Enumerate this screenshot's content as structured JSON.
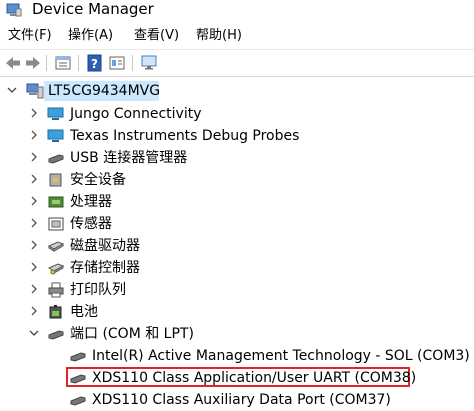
{
  "window": {
    "title": "Device Manager"
  },
  "menu": [
    {
      "label": "文件(F)"
    },
    {
      "label": "操作(A)"
    },
    {
      "label": "查看(V)"
    },
    {
      "label": "帮助(H)"
    }
  ],
  "toolbar": {
    "icons": [
      "back-arrow-icon",
      "forward-arrow-icon",
      "properties-icon",
      "help-icon",
      "details-icon",
      "monitor-icon"
    ]
  },
  "tree": {
    "root": {
      "label": "LT5CG9434MVG",
      "icon": "computer-icon"
    },
    "categories": [
      {
        "label": "Jungo Connectivity",
        "icon": "monitor-icon"
      },
      {
        "label": "Texas Instruments Debug Probes",
        "icon": "probe-icon"
      },
      {
        "label": "USB 连接器管理器",
        "icon": "usb-icon"
      },
      {
        "label": "安全设备",
        "icon": "security-icon"
      },
      {
        "label": "处理器",
        "icon": "chip-icon"
      },
      {
        "label": "传感器",
        "icon": "sensor-icon"
      },
      {
        "label": "磁盘驱动器",
        "icon": "disk-icon"
      },
      {
        "label": "存储控制器",
        "icon": "storage-icon"
      },
      {
        "label": "打印队列",
        "icon": "printer-icon"
      },
      {
        "label": "电池",
        "icon": "battery-icon"
      },
      {
        "label": "端口 (COM 和 LPT)",
        "icon": "port-icon"
      }
    ],
    "ports": [
      {
        "label": "Intel(R) Active Management Technology - SOL (COM3)"
      },
      {
        "label": "XDS110 Class Application/User UART (COM38)"
      },
      {
        "label": "XDS110 Class Auxiliary Data Port (COM37)"
      }
    ]
  },
  "colors": {
    "selection": "#cce8ff",
    "highlight_box": "#e0242c"
  }
}
